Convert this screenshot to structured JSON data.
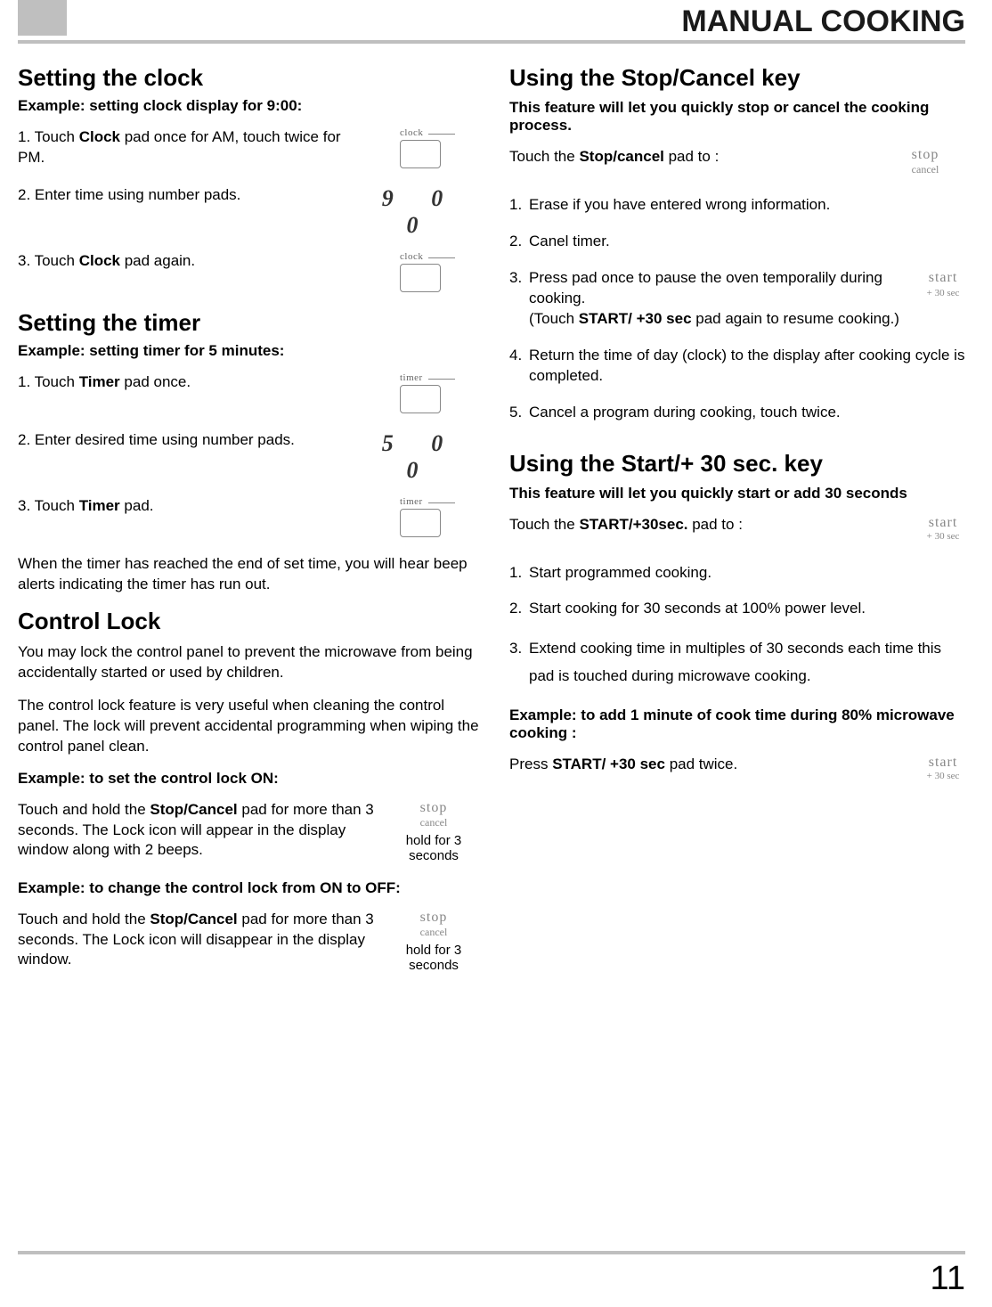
{
  "page_title": "MANUAL COOKING",
  "page_number": "11",
  "left": {
    "clock_heading": "Setting the clock",
    "clock_example": "Example: setting clock display for 9:00:",
    "clock_step1_pre": "1.  Touch ",
    "clock_step1_bold": "Clock",
    "clock_step1_post": " pad once for AM, touch twice for PM.",
    "clock_pad_label": "clock",
    "clock_step2": "2.  Enter time using number pads.",
    "clock_digits": "9   0   0",
    "clock_step3_pre": "3.  Touch ",
    "clock_step3_bold": "Clock",
    "clock_step3_post": " pad again.",
    "timer_heading": "Setting the timer",
    "timer_example": "Example: setting timer for 5 minutes:",
    "timer_step1_pre": "1.  Touch ",
    "timer_step1_bold": "Timer",
    "timer_step1_post": " pad once.",
    "timer_pad_label": "timer",
    "timer_step2": "2.  Enter desired time using number pads.",
    "timer_digits": "5   0   0",
    "timer_step3_pre": "3.  Touch ",
    "timer_step3_bold": "Timer",
    "timer_step3_post": " pad.",
    "timer_note": "When the timer has reached the end of set time, you will hear beep alerts indicating the timer has run out.",
    "lock_heading": "Control Lock",
    "lock_p1": "You may lock the control panel to prevent the microwave from being accidentally started or used by children.",
    "lock_p2": "The control lock feature is very useful when cleaning the control panel. The lock will prevent accidental programming when wiping the control panel clean.",
    "lock_on_example": "Example: to set the control lock ON:",
    "lock_on_text_pre": "Touch and hold the ",
    "lock_on_text_bold": "Stop/Cancel",
    "lock_on_text_post": " pad for more than 3 seconds. The Lock icon will appear in the display window along with 2 beeps.",
    "stop_l1": "stop",
    "stop_l2": "cancel",
    "hold_note": "hold for 3 seconds",
    "lock_off_example": "Example: to change the control lock from ON to OFF:",
    "lock_off_text_pre": "Touch and hold the ",
    "lock_off_text_bold": "Stop/Cancel",
    "lock_off_text_post": " pad for more than 3 seconds. The Lock icon will disappear in the display window."
  },
  "right": {
    "stop_heading": "Using the Stop/Cancel key",
    "stop_intro": "This feature will let you quickly stop or cancel the cooking process.",
    "stop_touch_pre": "Touch the  ",
    "stop_touch_bold": "Stop/cancel",
    "stop_touch_post": "  pad to :",
    "stop_l1": "stop",
    "stop_l2": "cancel",
    "stop_item1": "Erase if you have entered wrong information.",
    "stop_item2": "Canel timer.",
    "stop_item3a": "Press pad once to pause the oven temporalily during cooking.",
    "stop_item3b_pre": "(Touch ",
    "stop_item3b_bold": "START/ +30 sec",
    "stop_item3b_post": "  pad again to resume cooking.)",
    "start_l1": "start",
    "start_l2": "+ 30 sec",
    "stop_item4": "Return the time of day (clock) to the display after cooking cycle is completed.",
    "stop_item5": "Cancel a program during cooking, touch twice.",
    "start_heading_a": "Using the ",
    "start_heading_b": "Start/+ 30 sec.",
    "start_heading_c": " key",
    "start_intro": "This feature will let you quickly start or add 30 seconds",
    "start_touch_pre": "Touch the  ",
    "start_touch_bold": "START/+30sec.",
    "start_touch_post": "   pad to :",
    "start_item1": "Start programmed cooking.",
    "start_item2": "Start cooking for 30 seconds at 100% power level.",
    "start_item3": "Extend cooking time in multiples of 30 seconds each time this pad is touched during microwave cooking.",
    "start_example": "Example: to add 1 minute of cook time during 80% microwave cooking :",
    "start_press_pre": "Press  ",
    "start_press_bold": "START/ +30 sec",
    "start_press_post": "  pad twice."
  }
}
